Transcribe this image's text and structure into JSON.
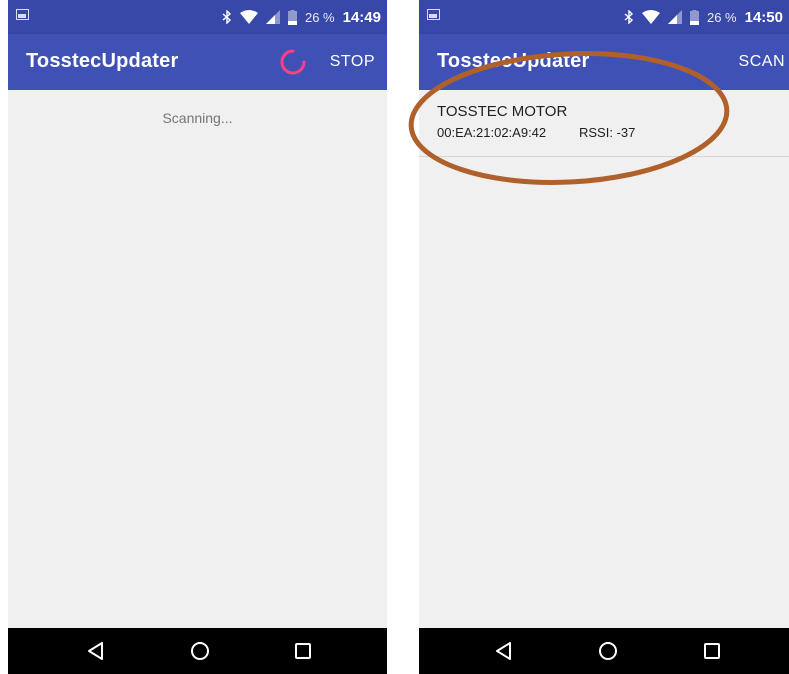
{
  "left_screen": {
    "status": {
      "battery_pct": "26 %",
      "time": "14:49"
    },
    "appbar": {
      "title": "TosstecUpdater",
      "action_label": "STOP"
    },
    "scanning_label": "Scanning..."
  },
  "right_screen": {
    "status": {
      "battery_pct": "26 %",
      "time": "14:50"
    },
    "appbar": {
      "title": "TosstecUpdater",
      "action_label": "SCAN"
    },
    "devices": [
      {
        "name": "TOSSTEC MOTOR",
        "address": "00:EA:21:02:A9:42",
        "rssi": "RSSI: -37"
      }
    ]
  },
  "colors": {
    "appbar": "#3f51b5",
    "statusbar": "#3848a8",
    "spinner": "#ff4081",
    "annotation": "#b0602a"
  }
}
